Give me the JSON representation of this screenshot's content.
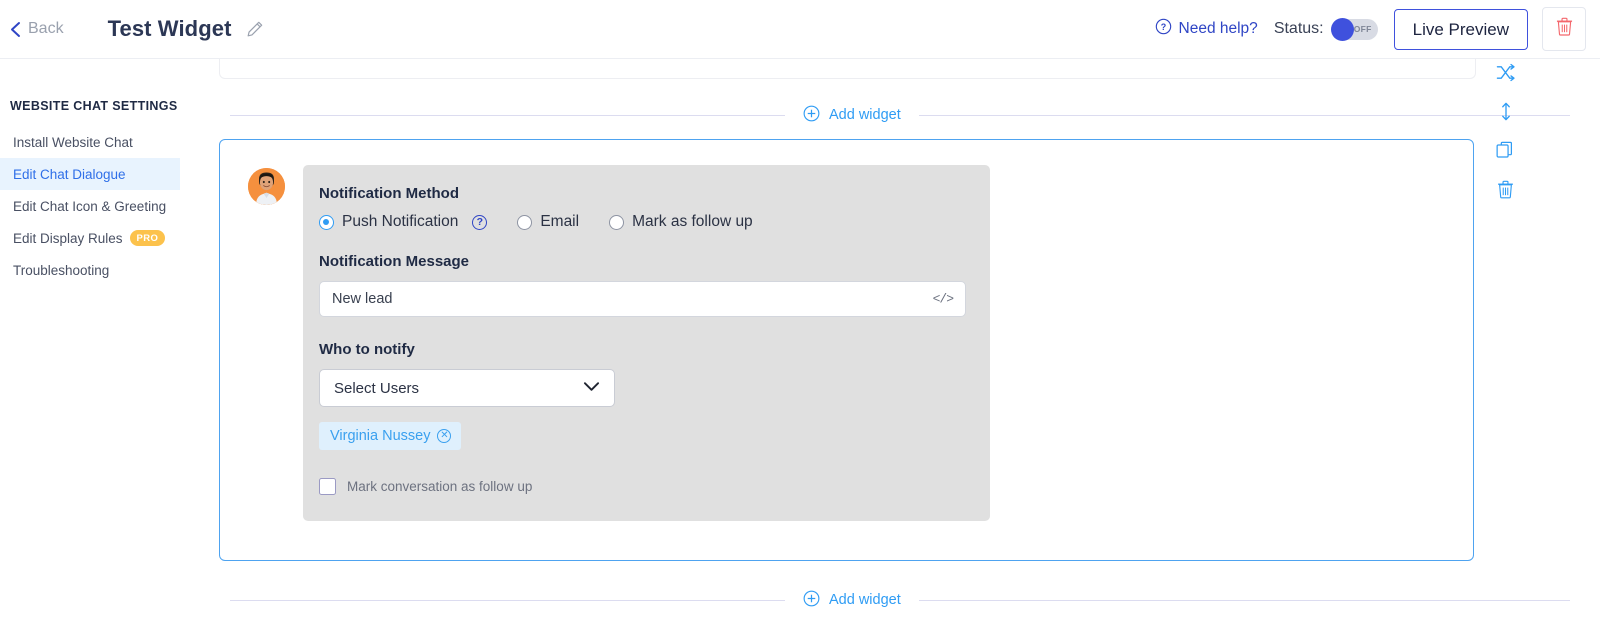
{
  "topbar": {
    "back_label": "Back",
    "title": "Test Widget",
    "edit_icon": "pencil-icon",
    "need_help_label": "Need help?",
    "help_icon": "question-circle-icon",
    "status_label": "Status:",
    "toggle_state": "OFF",
    "live_preview_label": "Live Preview",
    "delete_icon": "trash-icon",
    "accent_color": "#3f51dd",
    "delete_color": "#f4676c"
  },
  "sidebar": {
    "heading": "WEBSITE CHAT SETTINGS",
    "items": [
      {
        "label": "Install Website Chat",
        "active": false,
        "badge": ""
      },
      {
        "label": "Edit Chat Dialogue",
        "active": true,
        "badge": ""
      },
      {
        "label": "Edit Chat Icon & Greeting",
        "active": false,
        "badge": ""
      },
      {
        "label": "Edit Display Rules",
        "active": false,
        "badge": "PRO"
      },
      {
        "label": "Troubleshooting",
        "active": false,
        "badge": ""
      }
    ],
    "active_color": "#2f6fe8",
    "active_bg": "#e8f3fe",
    "badge_color": "#fcc24c"
  },
  "canvas": {
    "add_widget_label": "Add widget",
    "add_widget_icon": "plus-circle-icon",
    "link_color": "#2f9cf4"
  },
  "widget": {
    "avatar_name": "user-avatar",
    "notification_method": {
      "label": "Notification Method",
      "options": [
        {
          "label": "Push Notification",
          "selected": true,
          "has_help": true
        },
        {
          "label": "Email",
          "selected": false,
          "has_help": false
        },
        {
          "label": "Mark as follow up",
          "selected": false,
          "has_help": false
        }
      ]
    },
    "notification_message": {
      "label": "Notification Message",
      "value": "New lead",
      "placeholder": "New lead",
      "code_icon": "</>"
    },
    "who_to_notify": {
      "label": "Who to notify",
      "select_value": "Select Users",
      "chips": [
        {
          "label": "Virginia Nussey",
          "remove_icon": "x-circle-icon"
        }
      ]
    },
    "follow_up_checkbox": {
      "label": "Mark conversation as follow up",
      "checked": false
    },
    "border_color": "#4ea3f0",
    "panel_bg": "#e0e0e0"
  },
  "tools": [
    {
      "name": "shuffle-icon"
    },
    {
      "name": "move-vertical-icon"
    },
    {
      "name": "copy-icon"
    },
    {
      "name": "trash-icon"
    }
  ]
}
